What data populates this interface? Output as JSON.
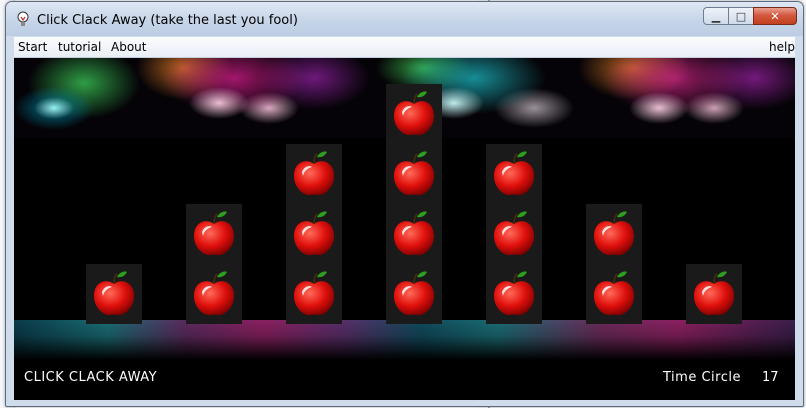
{
  "window": {
    "title": "Click Clack Away (take the last you fool)",
    "minimize_glyph": "▁",
    "maximize_glyph": "□",
    "close_glyph": "✕"
  },
  "menu": {
    "start": "Start",
    "tutorial": "tutorial",
    "about": "About",
    "help": "help"
  },
  "game": {
    "columns": [
      {
        "apples": 1
      },
      {
        "apples": 2
      },
      {
        "apples": 3
      },
      {
        "apples": 4
      },
      {
        "apples": 3
      },
      {
        "apples": 2
      },
      {
        "apples": 1
      }
    ],
    "apple_icon": "apple-icon",
    "apple_color": "#e0100c",
    "leaf_color": "#2e9e1f"
  },
  "hud": {
    "title": "CLICK CLACK AWAY",
    "label": "Time Circle",
    "count": "17"
  }
}
